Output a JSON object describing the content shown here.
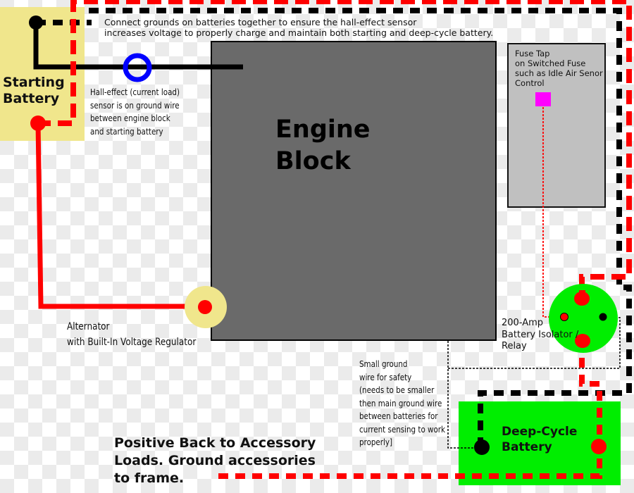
{
  "colors": {
    "positive_wire": "#ff0000",
    "ground_wire": "#000000",
    "signal_wire": "#ff0000",
    "starting_battery": "#f0e68c",
    "engine_block": "#6a6a6a",
    "fuse_box": "#c0c0c0",
    "fuse_tap": "#ff00ff",
    "isolator": "#00ee00",
    "deep_cycle_battery": "#00ee00",
    "hall_sensor": "#0000ff",
    "alternator": "#f0e68c"
  },
  "labels": {
    "connect_grounds_note": "Connect grounds on batteries together to ensure  the hall-effect sensor\nincreases voltage to properly charge and maintain both starting and deep-cycle battery.",
    "starting_battery": "Starting\nBattery",
    "hall_effect_note": "Hall-effect (current load)\nsensor is on ground wire\nbetween engine block\nand starting battery",
    "engine_block": "Engine\nBlock",
    "fuse_tap": "Fuse Tap\non Switched Fuse\nsuch as Idle Air Senor\nControl",
    "alternator": "Alternator\nwith Built-In Voltage Regulator",
    "isolator": "200-Amp\nBattery Isolator /\nRelay",
    "small_ground_note": "Small ground\nwire for safety\n(needs to be smaller\nthen main ground wire\nbetween batteries for\ncurrent sensing to work\nproperly]",
    "deep_cycle_battery": "Deep-Cycle\nBattery",
    "accessory_note": "Positive Back to Accessory\nLoads. Ground accessories\nto frame."
  }
}
